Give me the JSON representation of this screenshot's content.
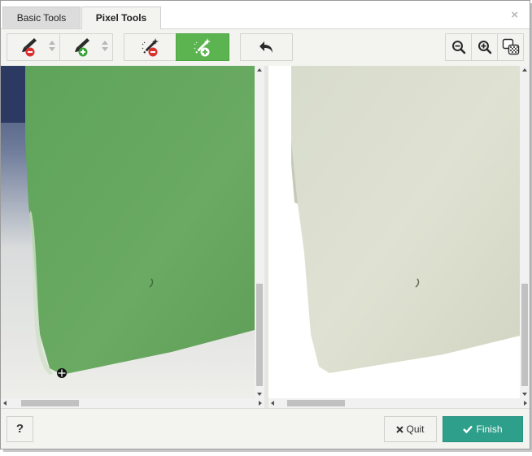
{
  "tabs": [
    {
      "label": "Basic Tools",
      "active": false
    },
    {
      "label": "Pixel Tools",
      "active": true
    }
  ],
  "close_icon": "×",
  "toolbar": {
    "brush_remove": {
      "icon": "brush-minus-icon",
      "color": "#d9322f"
    },
    "brush_add": {
      "icon": "brush-plus-icon",
      "color": "#3aa33a"
    },
    "wand_remove": {
      "icon": "magic-wand-minus-icon"
    },
    "wand_add": {
      "icon": "magic-wand-plus-icon",
      "active": true
    },
    "undo": {
      "icon": "undo-icon"
    },
    "zoom_out": {
      "icon": "zoom-out-icon"
    },
    "zoom_in": {
      "icon": "zoom-in-icon"
    },
    "toggle_view": {
      "icon": "toggle-background-icon"
    },
    "active_color": "#5cb450"
  },
  "footer": {
    "help_label": "?",
    "quit_label": "Quit",
    "finish_label": "Finish",
    "finish_color": "#2d9f8a"
  }
}
